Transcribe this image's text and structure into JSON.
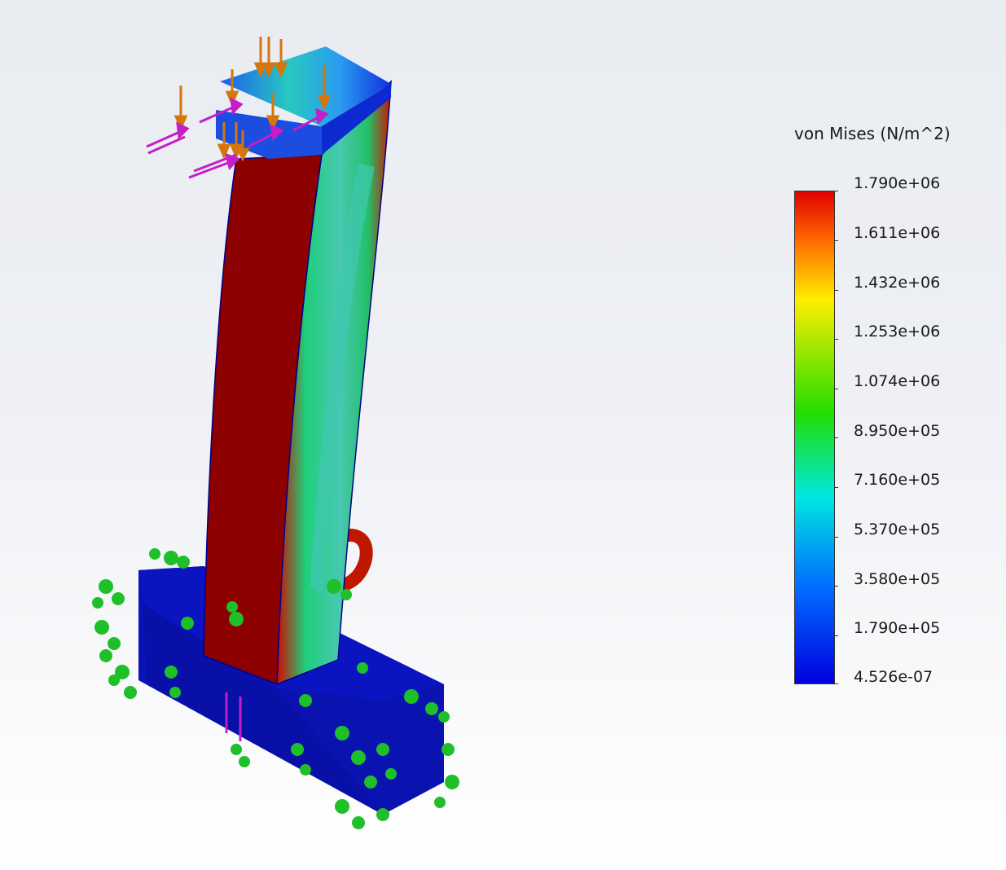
{
  "legend": {
    "title": "von Mises (N/m^2)",
    "ticks": [
      "1.790e+06",
      "1.611e+06",
      "1.432e+06",
      "1.253e+06",
      "1.074e+06",
      "8.950e+05",
      "7.160e+05",
      "5.370e+05",
      "3.580e+05",
      "1.790e+05",
      "4.526e-07"
    ]
  },
  "colors": {
    "max": "#e00000",
    "high": "#ff7a00",
    "mid_high": "#ffff00",
    "mid": "#00e000",
    "mid_low": "#00ffff",
    "low": "#0040ff",
    "min": "#0000e0",
    "load_arrow": "#d4760a",
    "pressure_arrow": "#c41ec8",
    "fixture": "#1fbf2a"
  }
}
